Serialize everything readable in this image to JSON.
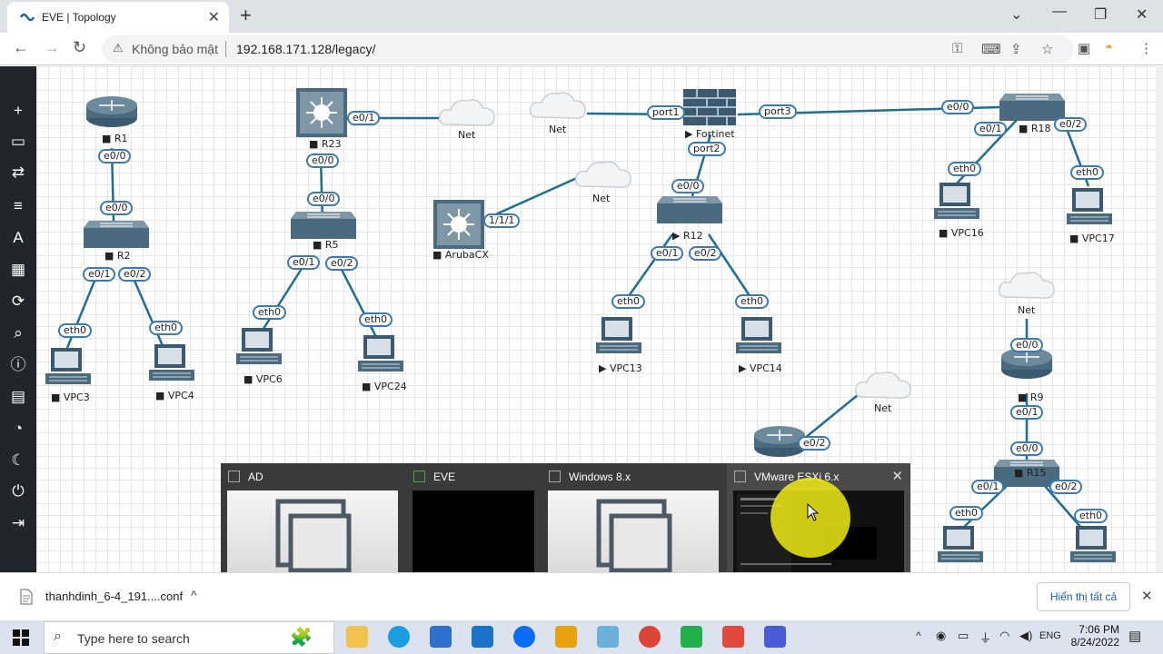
{
  "browser": {
    "tab_title": "EVE | Topology",
    "tab_close": "✕",
    "new_tab": "+",
    "security_label": "Không bảo mật",
    "url": "192.168.171.128/legacy/"
  },
  "topology": {
    "nodes": {
      "r1": "R1",
      "r2": "R2",
      "vpc3": "VPC3",
      "vpc4": "VPC4",
      "r23": "R23",
      "r5": "R5",
      "vpc6": "VPC6",
      "vpc24": "VPC24",
      "net1": "Net",
      "net2": "Net",
      "net3": "Net",
      "net4": "Net",
      "net5": "Net",
      "arubacx": "ArubaCX",
      "fortinet": "Fortinet",
      "r12": "R12",
      "vpc13": "VPC13",
      "vpc14": "VPC14",
      "r18": "R18",
      "vpc16": "VPC16",
      "vpc17": "VPC17",
      "r9": "R9",
      "r15": "R15"
    },
    "ports": {
      "r1_e00": "e0/0",
      "r2_e00": "e0/0",
      "r2_e01": "e0/1",
      "r2_e02": "e0/2",
      "vpc3_eth0": "eth0",
      "vpc4_eth0": "eth0",
      "r23_e01": "e0/1",
      "r23_e00": "e0/0",
      "r5_e00": "e0/0",
      "r5_e01": "e0/1",
      "r5_e02": "e0/2",
      "vpc6_eth0": "eth0",
      "vpc24_eth0": "eth0",
      "aruba_port": "1/1/1",
      "fw_port1": "port1",
      "fw_port2": "port2",
      "fw_port3": "port3",
      "r12_e00": "e0/0",
      "r12_e01": "e0/1",
      "r12_e02": "e0/2",
      "vpc13_eth0": "eth0",
      "vpc14_eth0": "eth0",
      "r18_e00": "e0/0",
      "r18_e01": "e0/1",
      "r18_e02": "e0/2",
      "vpc16_eth0": "eth0",
      "vpc17_eth0": "eth0",
      "r9_e00a": "e0/0",
      "r9_e01": "e0/1",
      "r15_e00": "e0/0",
      "r15_e01": "e0/1",
      "r15_e02": "e0/2",
      "vpc_a_eth0": "eth0",
      "vpc_b_eth0": "eth0",
      "router_bottom_e02": "e0/2"
    }
  },
  "switcher": {
    "items": [
      {
        "title": "AD"
      },
      {
        "title": "EVE"
      },
      {
        "title": "Windows 8.x"
      },
      {
        "title": "VMware ESXi 6.x"
      }
    ],
    "close": "✕"
  },
  "downloads": {
    "file": "thanhdinh_6-4_191....conf",
    "show_all": "Hiển thị tất cả"
  },
  "taskbar": {
    "search_placeholder": "Type here to search",
    "lang": "ENG",
    "time": "7:06 PM",
    "date": "8/24/2022"
  },
  "colors": {
    "link": "#1f6f91",
    "node": "#3c5a6f",
    "pill_border": "#3b7bb0",
    "sidebar": "#20262c"
  }
}
